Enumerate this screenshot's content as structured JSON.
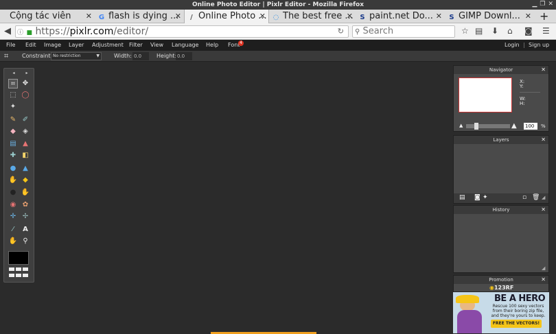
{
  "window": {
    "title": "Online Photo Editor | Pixlr Editor - Mozilla Firefox"
  },
  "tabs": [
    {
      "label": "Cộng tác viên",
      "icon": "page-icon"
    },
    {
      "label": "flash is dying ...",
      "icon": "google-icon"
    },
    {
      "label": "Online Photo ...",
      "icon": "pencil-icon",
      "active": true
    },
    {
      "label": "The best free ...",
      "icon": "loading-icon"
    },
    {
      "label": "paint.net Do...",
      "icon": "s-logo-icon"
    },
    {
      "label": "GIMP Downl...",
      "icon": "s-logo-icon"
    }
  ],
  "new_tab": "+",
  "address": {
    "url_prefix": "https://",
    "url_domain": "pixlr.com",
    "url_path": "/editor/",
    "search_placeholder": "Search"
  },
  "menu": {
    "items": [
      "File",
      "Edit",
      "Image",
      "Layer",
      "Adjustment",
      "Filter",
      "View",
      "Language",
      "Help",
      "Font"
    ],
    "font_badge": "4",
    "login": "Login",
    "separator": "|",
    "signup": "Sign up"
  },
  "options": {
    "constraint_label": "Constraint:",
    "constraint_value": "No restriction",
    "width_label": "Width:",
    "width_value": "0.0",
    "height_label": "Height:",
    "height_value": "0.0"
  },
  "navigator": {
    "title": "Navigator",
    "x_label": "X:",
    "y_label": "Y:",
    "w_label": "W:",
    "h_label": "H:",
    "zoom": "100",
    "zoom_unit": "%",
    "zoom_slider_level": 0.2
  },
  "layers": {
    "title": "Layers"
  },
  "history": {
    "title": "History"
  },
  "promotion": {
    "title": "Promotion",
    "brand": "123RF",
    "headline": "BE A HERO",
    "body_line1": "Rescue 100 sexy vectors",
    "body_line2": "from their boring zip file,",
    "body_line3": "and they're yours to keep.",
    "cta": "FREE THE VECTORS!"
  },
  "colors": {
    "app_bg": "#2b2b2b",
    "menubar": "#1e1e1e",
    "panel": "#4a4a4a",
    "accent_red": "#d32f2f",
    "promo_yellow": "#f5c518",
    "promo_blue": "#c7dbe8"
  }
}
